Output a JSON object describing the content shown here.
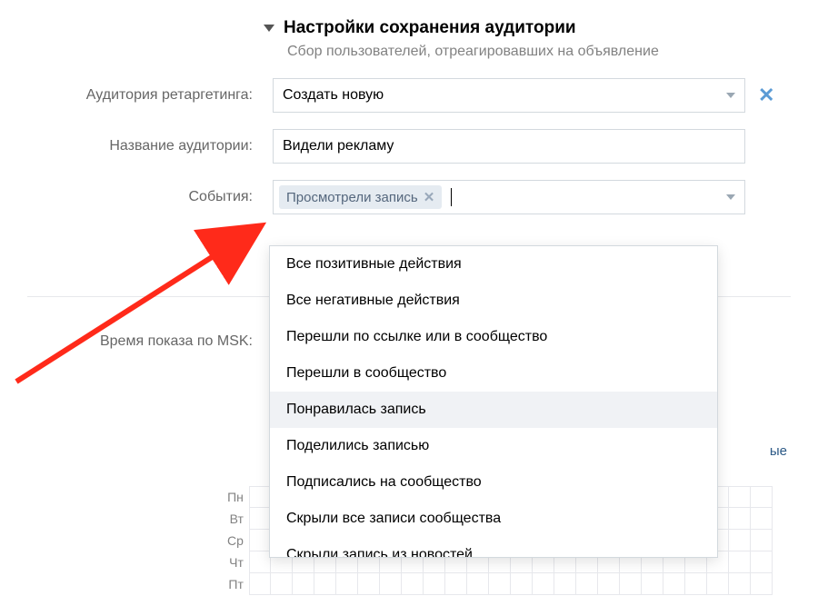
{
  "section": {
    "title": "Настройки сохранения аудитории",
    "subtitle": "Сбор пользователей, отреагировавших на объявление"
  },
  "retargeting": {
    "label": "Аудитория ретаргетинга:",
    "selected": "Создать новую"
  },
  "audience_name": {
    "label": "Название аудитории:",
    "value": "Видели рекламу"
  },
  "events": {
    "label": "События:",
    "selected_tags": [
      "Просмотрели запись"
    ],
    "options": [
      "Все позитивные действия",
      "Все негативные действия",
      "Перешли по ссылке или в сообщество",
      "Перешли в сообщество",
      "Понравилась запись",
      "Поделились записью",
      "Подписались на сообщество",
      "Скрыли все записи сообщества",
      "Скрыли запись из новостей"
    ],
    "highlighted_index": 4
  },
  "schedule": {
    "label": "Время показа по MSK:",
    "right_link_suffix": "ые",
    "days": [
      "Пн",
      "Вт",
      "Ср",
      "Чт",
      "Пт"
    ]
  },
  "colors": {
    "accent": "#2a5885",
    "tag_bg": "#e5ebf1",
    "border": "#d3d9de",
    "arrow": "#ff2a1a"
  }
}
